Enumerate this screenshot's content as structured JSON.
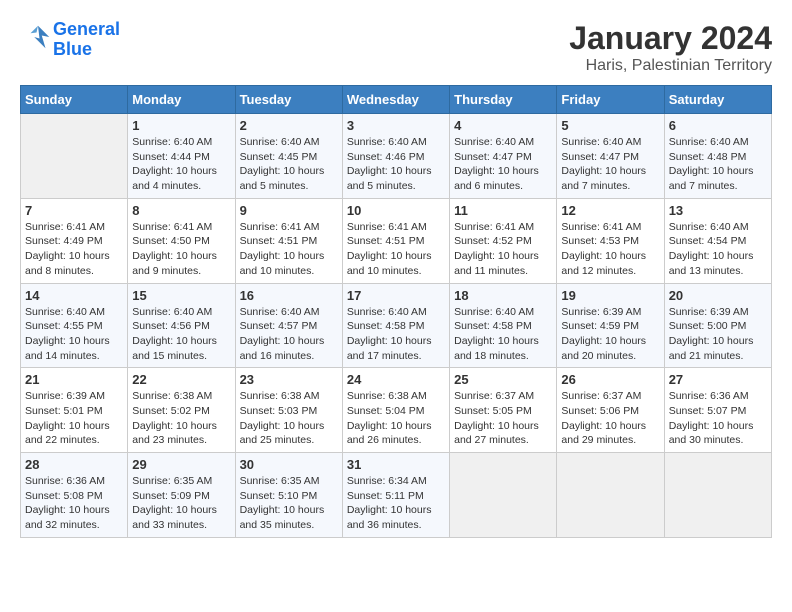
{
  "logo": {
    "text_general": "General",
    "text_blue": "Blue"
  },
  "title": "January 2024",
  "subtitle": "Haris, Palestinian Territory",
  "headers": [
    "Sunday",
    "Monday",
    "Tuesday",
    "Wednesday",
    "Thursday",
    "Friday",
    "Saturday"
  ],
  "weeks": [
    [
      {
        "day": "",
        "sunrise": "",
        "sunset": "",
        "daylight": "",
        "empty": true
      },
      {
        "day": "1",
        "sunrise": "Sunrise: 6:40 AM",
        "sunset": "Sunset: 4:44 PM",
        "daylight": "Daylight: 10 hours and 4 minutes."
      },
      {
        "day": "2",
        "sunrise": "Sunrise: 6:40 AM",
        "sunset": "Sunset: 4:45 PM",
        "daylight": "Daylight: 10 hours and 5 minutes."
      },
      {
        "day": "3",
        "sunrise": "Sunrise: 6:40 AM",
        "sunset": "Sunset: 4:46 PM",
        "daylight": "Daylight: 10 hours and 5 minutes."
      },
      {
        "day": "4",
        "sunrise": "Sunrise: 6:40 AM",
        "sunset": "Sunset: 4:47 PM",
        "daylight": "Daylight: 10 hours and 6 minutes."
      },
      {
        "day": "5",
        "sunrise": "Sunrise: 6:40 AM",
        "sunset": "Sunset: 4:47 PM",
        "daylight": "Daylight: 10 hours and 7 minutes."
      },
      {
        "day": "6",
        "sunrise": "Sunrise: 6:40 AM",
        "sunset": "Sunset: 4:48 PM",
        "daylight": "Daylight: 10 hours and 7 minutes."
      }
    ],
    [
      {
        "day": "7",
        "sunrise": "Sunrise: 6:41 AM",
        "sunset": "Sunset: 4:49 PM",
        "daylight": "Daylight: 10 hours and 8 minutes."
      },
      {
        "day": "8",
        "sunrise": "Sunrise: 6:41 AM",
        "sunset": "Sunset: 4:50 PM",
        "daylight": "Daylight: 10 hours and 9 minutes."
      },
      {
        "day": "9",
        "sunrise": "Sunrise: 6:41 AM",
        "sunset": "Sunset: 4:51 PM",
        "daylight": "Daylight: 10 hours and 10 minutes."
      },
      {
        "day": "10",
        "sunrise": "Sunrise: 6:41 AM",
        "sunset": "Sunset: 4:51 PM",
        "daylight": "Daylight: 10 hours and 10 minutes."
      },
      {
        "day": "11",
        "sunrise": "Sunrise: 6:41 AM",
        "sunset": "Sunset: 4:52 PM",
        "daylight": "Daylight: 10 hours and 11 minutes."
      },
      {
        "day": "12",
        "sunrise": "Sunrise: 6:41 AM",
        "sunset": "Sunset: 4:53 PM",
        "daylight": "Daylight: 10 hours and 12 minutes."
      },
      {
        "day": "13",
        "sunrise": "Sunrise: 6:40 AM",
        "sunset": "Sunset: 4:54 PM",
        "daylight": "Daylight: 10 hours and 13 minutes."
      }
    ],
    [
      {
        "day": "14",
        "sunrise": "Sunrise: 6:40 AM",
        "sunset": "Sunset: 4:55 PM",
        "daylight": "Daylight: 10 hours and 14 minutes."
      },
      {
        "day": "15",
        "sunrise": "Sunrise: 6:40 AM",
        "sunset": "Sunset: 4:56 PM",
        "daylight": "Daylight: 10 hours and 15 minutes."
      },
      {
        "day": "16",
        "sunrise": "Sunrise: 6:40 AM",
        "sunset": "Sunset: 4:57 PM",
        "daylight": "Daylight: 10 hours and 16 minutes."
      },
      {
        "day": "17",
        "sunrise": "Sunrise: 6:40 AM",
        "sunset": "Sunset: 4:58 PM",
        "daylight": "Daylight: 10 hours and 17 minutes."
      },
      {
        "day": "18",
        "sunrise": "Sunrise: 6:40 AM",
        "sunset": "Sunset: 4:58 PM",
        "daylight": "Daylight: 10 hours and 18 minutes."
      },
      {
        "day": "19",
        "sunrise": "Sunrise: 6:39 AM",
        "sunset": "Sunset: 4:59 PM",
        "daylight": "Daylight: 10 hours and 20 minutes."
      },
      {
        "day": "20",
        "sunrise": "Sunrise: 6:39 AM",
        "sunset": "Sunset: 5:00 PM",
        "daylight": "Daylight: 10 hours and 21 minutes."
      }
    ],
    [
      {
        "day": "21",
        "sunrise": "Sunrise: 6:39 AM",
        "sunset": "Sunset: 5:01 PM",
        "daylight": "Daylight: 10 hours and 22 minutes."
      },
      {
        "day": "22",
        "sunrise": "Sunrise: 6:38 AM",
        "sunset": "Sunset: 5:02 PM",
        "daylight": "Daylight: 10 hours and 23 minutes."
      },
      {
        "day": "23",
        "sunrise": "Sunrise: 6:38 AM",
        "sunset": "Sunset: 5:03 PM",
        "daylight": "Daylight: 10 hours and 25 minutes."
      },
      {
        "day": "24",
        "sunrise": "Sunrise: 6:38 AM",
        "sunset": "Sunset: 5:04 PM",
        "daylight": "Daylight: 10 hours and 26 minutes."
      },
      {
        "day": "25",
        "sunrise": "Sunrise: 6:37 AM",
        "sunset": "Sunset: 5:05 PM",
        "daylight": "Daylight: 10 hours and 27 minutes."
      },
      {
        "day": "26",
        "sunrise": "Sunrise: 6:37 AM",
        "sunset": "Sunset: 5:06 PM",
        "daylight": "Daylight: 10 hours and 29 minutes."
      },
      {
        "day": "27",
        "sunrise": "Sunrise: 6:36 AM",
        "sunset": "Sunset: 5:07 PM",
        "daylight": "Daylight: 10 hours and 30 minutes."
      }
    ],
    [
      {
        "day": "28",
        "sunrise": "Sunrise: 6:36 AM",
        "sunset": "Sunset: 5:08 PM",
        "daylight": "Daylight: 10 hours and 32 minutes."
      },
      {
        "day": "29",
        "sunrise": "Sunrise: 6:35 AM",
        "sunset": "Sunset: 5:09 PM",
        "daylight": "Daylight: 10 hours and 33 minutes."
      },
      {
        "day": "30",
        "sunrise": "Sunrise: 6:35 AM",
        "sunset": "Sunset: 5:10 PM",
        "daylight": "Daylight: 10 hours and 35 minutes."
      },
      {
        "day": "31",
        "sunrise": "Sunrise: 6:34 AM",
        "sunset": "Sunset: 5:11 PM",
        "daylight": "Daylight: 10 hours and 36 minutes."
      },
      {
        "day": "",
        "sunrise": "",
        "sunset": "",
        "daylight": "",
        "empty": true
      },
      {
        "day": "",
        "sunrise": "",
        "sunset": "",
        "daylight": "",
        "empty": true
      },
      {
        "day": "",
        "sunrise": "",
        "sunset": "",
        "daylight": "",
        "empty": true
      }
    ]
  ]
}
